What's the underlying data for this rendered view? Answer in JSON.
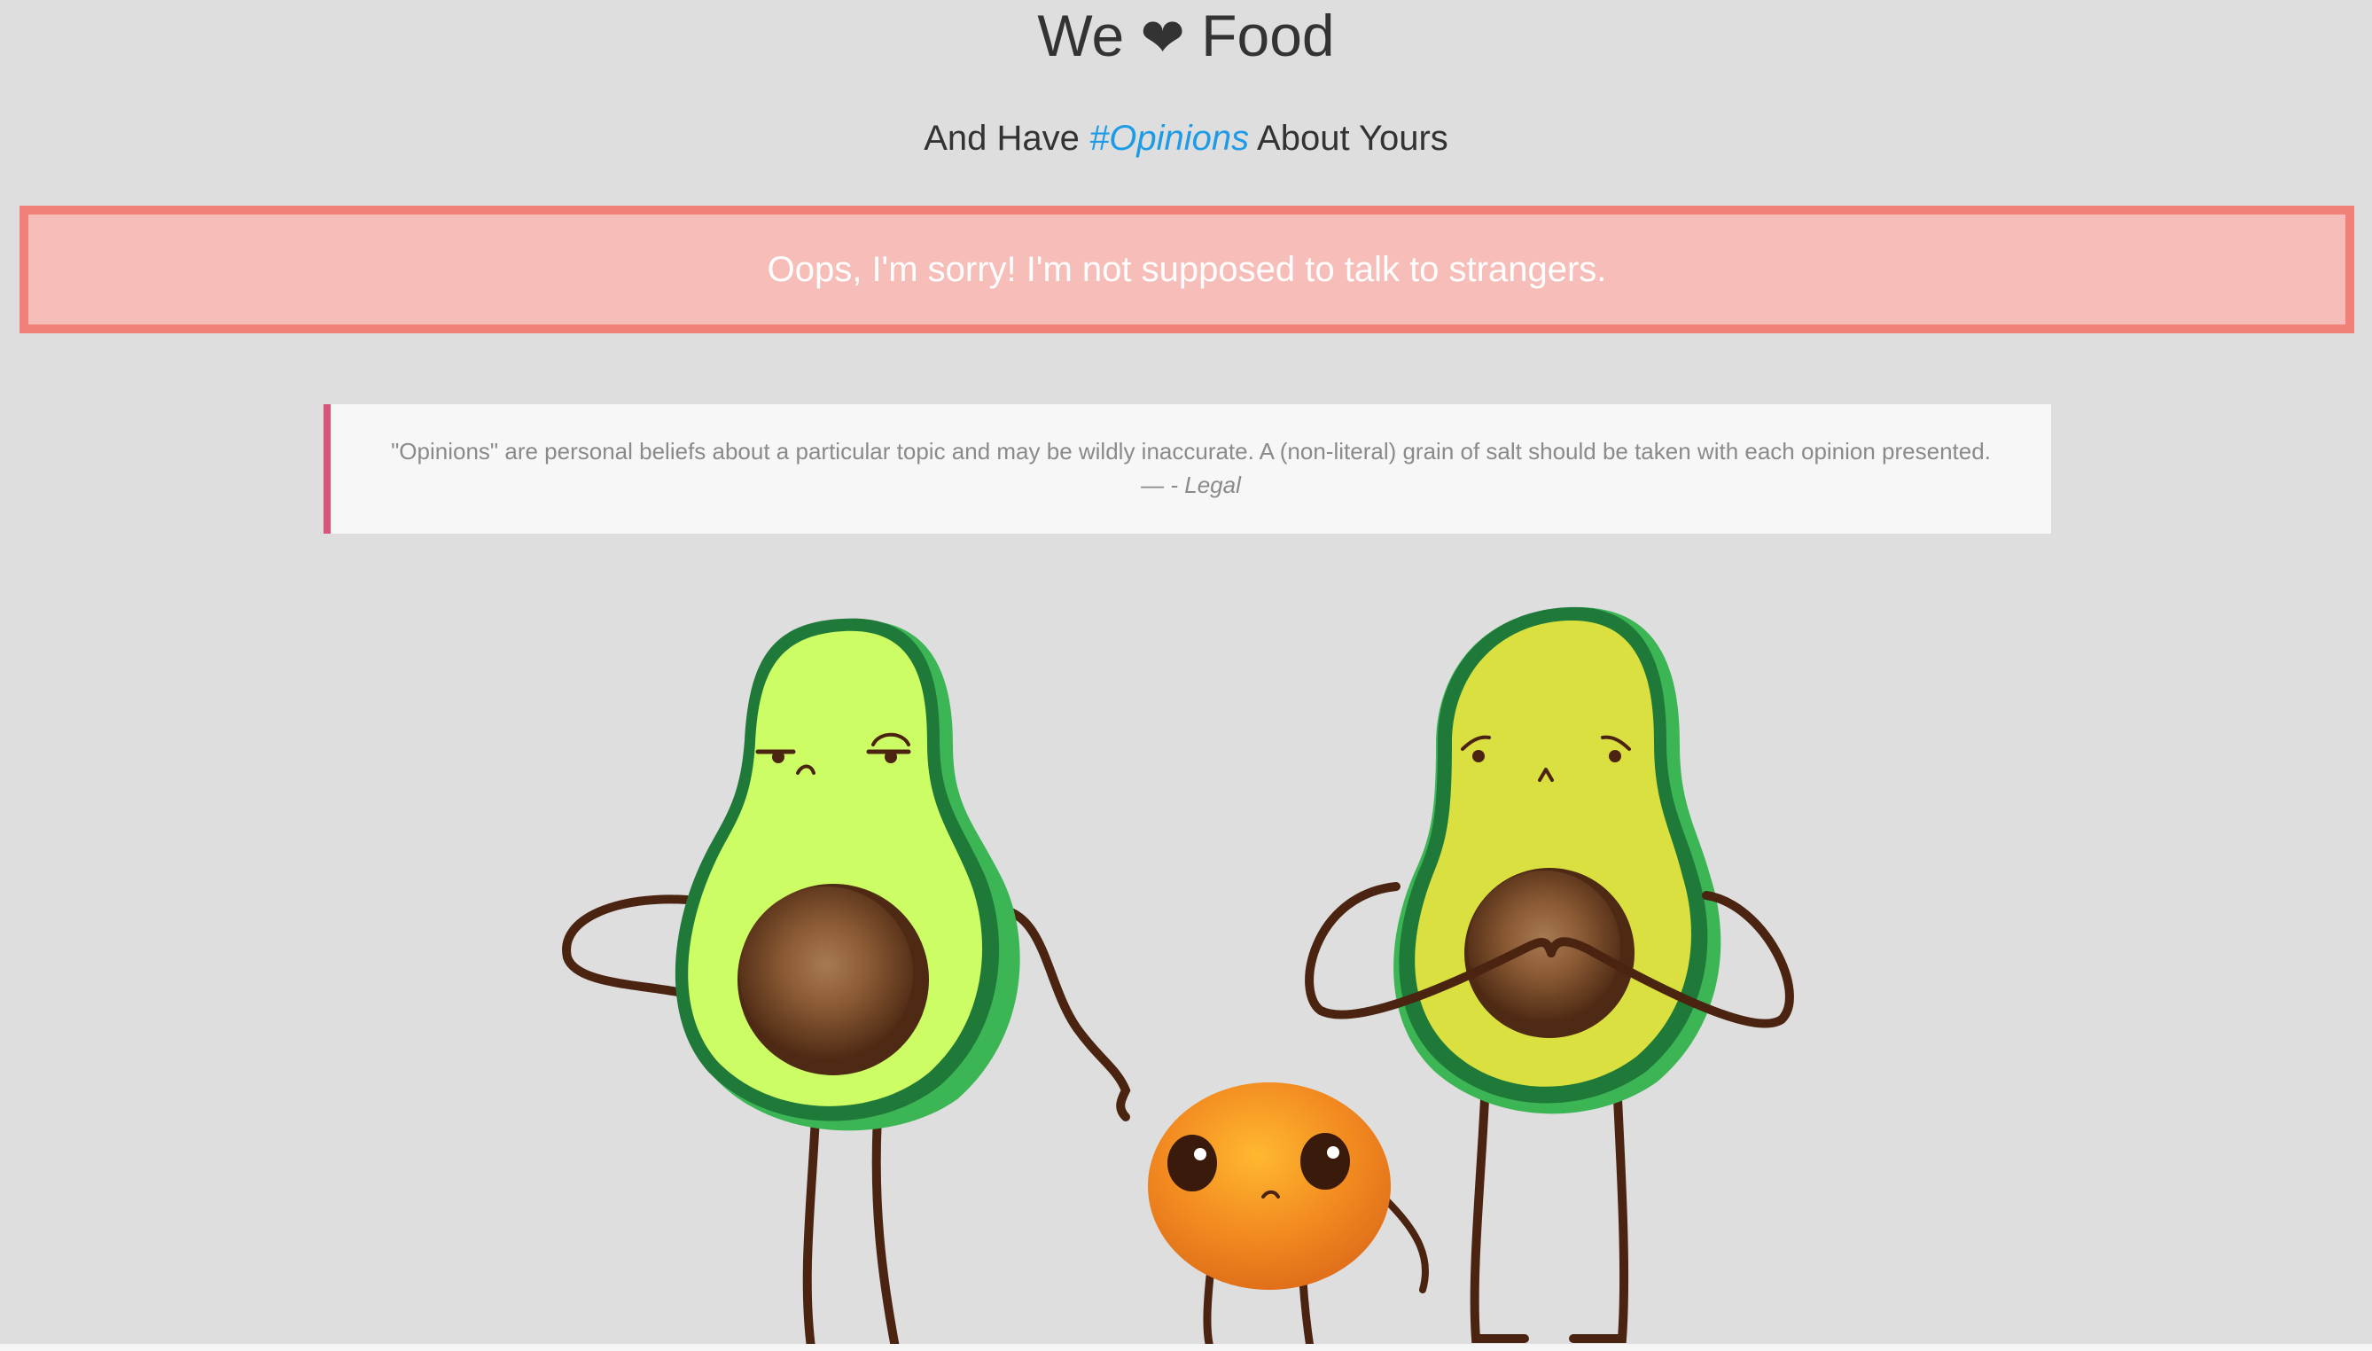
{
  "header": {
    "title_prefix": "We",
    "heart_glyph": "❤",
    "title_suffix": "Food"
  },
  "subtitle": {
    "before": "And Have ",
    "hashtag": "#Opinions",
    "after": " About Yours"
  },
  "alert": {
    "message": "Oops, I'm sorry! I'm not supposed to talk to strangers."
  },
  "quote": {
    "text": "\"Opinions\" are personal beliefs about a particular topic and may be wildly inaccurate. A (non-literal) grain of salt should be taken with each opinion presented.",
    "dash": "— ",
    "source": "- Legal"
  },
  "colors": {
    "background": "#dedede",
    "alert_bg": "#f7bdb8",
    "alert_border": "#f08078",
    "hashtag": "#1e9be6",
    "quote_border": "#d9547a",
    "avocado_light": "#cdfd64",
    "avocado_dark": "#d9e03f",
    "avocado_rind": "#1f7a3a",
    "pit": "#7a4a28",
    "orange": "#f28a20"
  },
  "icons": {
    "heart": "heart-icon"
  }
}
